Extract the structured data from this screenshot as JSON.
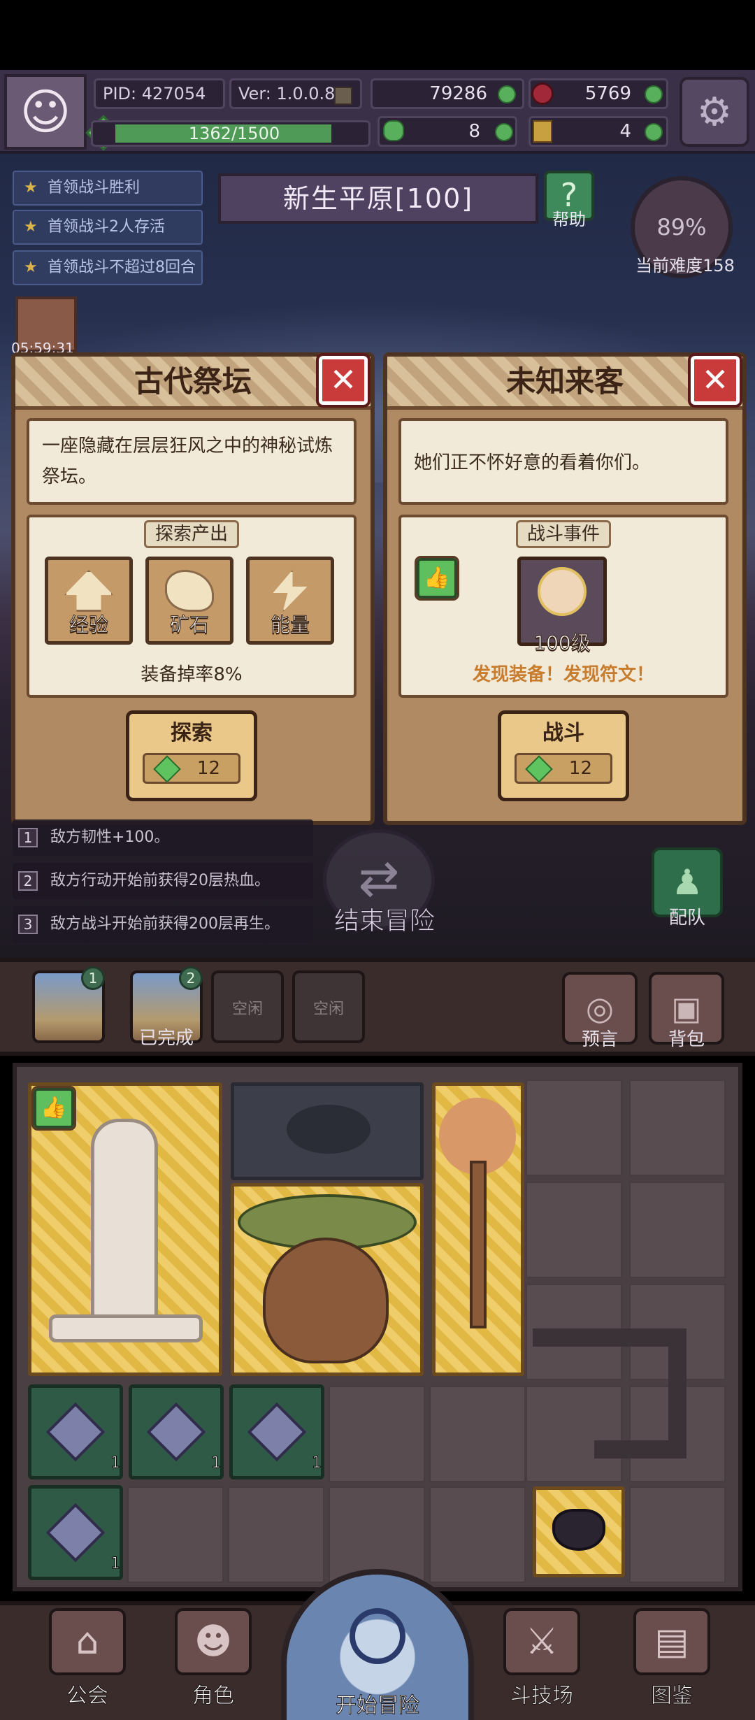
{
  "header": {
    "pid": "PID: 427054",
    "version": "Ver: 1.0.0.8",
    "coins": "79286",
    "gems": "5769",
    "exp": "1362/1500",
    "exp_fraction": 0.908,
    "clover": "8",
    "keys": "4"
  },
  "quests": [
    {
      "label": "首领战斗胜利"
    },
    {
      "label": "首领战斗2人存活"
    },
    {
      "label": "首领战斗不超过8回合"
    }
  ],
  "area": {
    "title": "新生平原[100]",
    "help_label": "帮助",
    "difficulty_percent": "89%",
    "difficulty_label": "当前难度158",
    "chest_timer": "05:59:31"
  },
  "panel_left": {
    "title": "古代祭坛",
    "desc": "一座隐藏在层层狂风之中的神秘试炼祭坛。",
    "section_title": "探索产出",
    "yields": [
      {
        "label": "经验",
        "icon": "arrow-up-icon"
      },
      {
        "label": "矿石",
        "icon": "ore-icon"
      },
      {
        "label": "能量",
        "icon": "lightning-icon"
      }
    ],
    "drop_rate": "装备掉率8%",
    "action_label": "探索",
    "cost": "12"
  },
  "panel_right": {
    "title": "未知来客",
    "desc": "她们正不怀好意的看着你们。",
    "section_title": "战斗事件",
    "enemy_level": "100级",
    "reward": "发现装备！发现符文！",
    "action_label": "战斗",
    "cost": "12"
  },
  "modifiers": [
    {
      "num": "1",
      "text": "敌方韧性+100。"
    },
    {
      "num": "2",
      "text": "敌方行动开始前获得20层热血。"
    },
    {
      "num": "3",
      "text": "敌方战斗开始前获得200层再生。"
    }
  ],
  "end_adventure_label": "结束冒险",
  "team_label": "配队",
  "slots": {
    "slot1_badge": "1",
    "slot2_badge": "2",
    "slot2_caption": "已完成",
    "idle1": "空闲",
    "idle2": "空闲",
    "prophecy_label": "预言",
    "backpack_label": "背包"
  },
  "inventory": {
    "crystal_qty": [
      "1",
      "1",
      "1",
      "1"
    ]
  },
  "nav": {
    "guild": "公会",
    "character": "角色",
    "start": "开始冒险",
    "arena": "斗技场",
    "codex": "图鉴"
  },
  "colors": {
    "panel_brown": "#b08a62",
    "close_red": "#c93a3a",
    "reward_orange": "#c77c2e",
    "gem_green": "#5fc45f"
  }
}
